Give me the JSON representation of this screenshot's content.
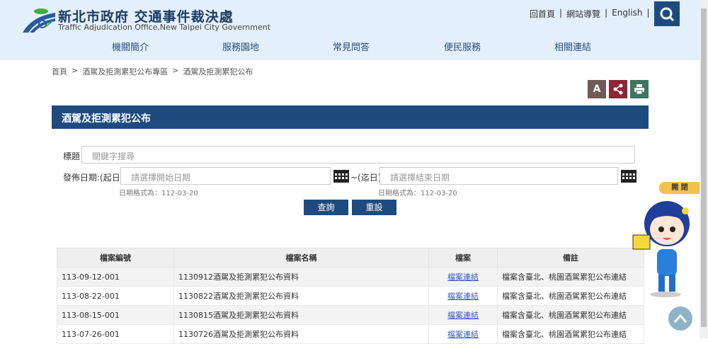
{
  "header": {
    "title_zh": "新北市政府 交通事件裁決處",
    "title_en": "Traffic Adjudication Office,New Taipei City Government",
    "links": [
      "回首頁",
      "網站導覽",
      "English"
    ]
  },
  "nav": [
    "機關簡介",
    "服務園地",
    "常見問答",
    "便民服務",
    "相關連結"
  ],
  "breadcrumb": [
    "首頁",
    "酒駕及拒測累犯公布專區",
    "酒駕及拒測累犯公布"
  ],
  "tools": {
    "font": "A"
  },
  "section_title": "酒駕及拒測累犯公布",
  "form": {
    "title_label": "標題",
    "title_placeholder": "關鍵字搜尋",
    "date_label": "發佈日期:(起日)",
    "start_placeholder": "請選擇開始日期",
    "end_label": "~(迄日)",
    "end_placeholder": "請選擇結束日期",
    "hint": "日期格式為：112-03-20",
    "search": "查詢",
    "reset": "重設"
  },
  "table": {
    "headers": [
      "檔案編號",
      "檔案名稱",
      "檔案",
      "備註"
    ],
    "rows": [
      {
        "id": "113-09-12-001",
        "name": "1130912酒駕及拒測累犯公布資料",
        "file": "檔案連結",
        "note": "檔案含臺北、桃園酒駕累犯公布連結"
      },
      {
        "id": "113-08-22-001",
        "name": "1130822酒駕及拒測累犯公布資料",
        "file": "檔案連結",
        "note": "檔案含臺北、桃園酒駕累犯公布連結"
      },
      {
        "id": "113-08-15-001",
        "name": "1130815酒駕及拒測累犯公布資料",
        "file": "檔案連結",
        "note": "檔案含臺北、桃園酒駕累犯公布連結"
      },
      {
        "id": "113-07-26-001",
        "name": "1130726酒駕及拒測累犯公布資料",
        "file": "檔案連結",
        "note": "檔案含臺北、桃園酒駕累犯公布連結"
      }
    ]
  },
  "mascot_toggle": "開 閉"
}
